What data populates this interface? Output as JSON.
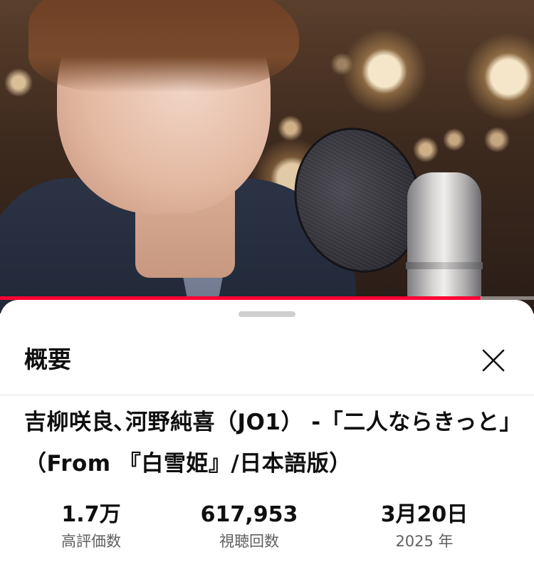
{
  "video": {
    "progress_fraction": 0.9
  },
  "panel": {
    "title": "概要",
    "close_icon": "close-icon",
    "video_title": "吉柳咲良､河野純喜（JO1） -「二人ならきっと」（From 『白雪姫』/日本語版）"
  },
  "stats": [
    {
      "value": "1.7万",
      "label": "高評価数"
    },
    {
      "value": "617,953",
      "label": "視聴回数"
    },
    {
      "value": "3月20日",
      "label": "2025 年"
    }
  ],
  "colors": {
    "progress": "#ff0033",
    "text_primary": "#0f0f0f",
    "text_secondary": "#606060"
  }
}
